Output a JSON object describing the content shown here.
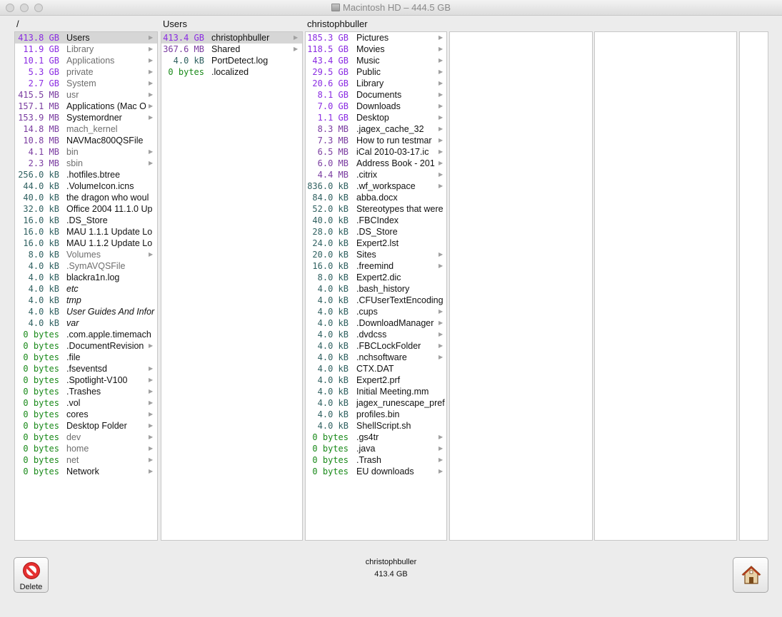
{
  "window": {
    "title": "Macintosh HD – 444.5 GB"
  },
  "columns": [
    {
      "header": "/",
      "rows": [
        {
          "size": "413.8 GB",
          "unit": "gb",
          "name": "Users",
          "arrow": true,
          "selected": true
        },
        {
          "size": "11.9 GB",
          "unit": "gb",
          "name": "Library",
          "arrow": true,
          "gray": true
        },
        {
          "size": "10.1 GB",
          "unit": "gb",
          "name": "Applications",
          "arrow": true,
          "gray": true
        },
        {
          "size": "5.3 GB",
          "unit": "gb",
          "name": "private",
          "arrow": true,
          "gray": true
        },
        {
          "size": "2.7 GB",
          "unit": "gb",
          "name": "System",
          "arrow": true,
          "gray": true
        },
        {
          "size": "415.5 MB",
          "unit": "mb",
          "name": "usr",
          "arrow": true,
          "gray": true
        },
        {
          "size": "157.1 MB",
          "unit": "mb",
          "name": "Applications (Mac O",
          "arrow": true
        },
        {
          "size": "153.9 MB",
          "unit": "mb",
          "name": "Systemordner",
          "arrow": true
        },
        {
          "size": "14.8 MB",
          "unit": "mb",
          "name": "mach_kernel",
          "gray": true
        },
        {
          "size": "10.8 MB",
          "unit": "mb",
          "name": "NAVMac800QSFile"
        },
        {
          "size": "4.1 MB",
          "unit": "mb",
          "name": "bin",
          "arrow": true,
          "gray": true
        },
        {
          "size": "2.3 MB",
          "unit": "mb",
          "name": "sbin",
          "arrow": true,
          "gray": true
        },
        {
          "size": "256.0 kB",
          "unit": "kb",
          "name": ".hotfiles.btree"
        },
        {
          "size": "44.0 kB",
          "unit": "kb",
          "name": ".VolumeIcon.icns"
        },
        {
          "size": "40.0 kB",
          "unit": "kb",
          "name": "the dragon who woul"
        },
        {
          "size": "32.0 kB",
          "unit": "kb",
          "name": "Office 2004 11.1.0 Up"
        },
        {
          "size": "16.0 kB",
          "unit": "kb",
          "name": ".DS_Store"
        },
        {
          "size": "16.0 kB",
          "unit": "kb",
          "name": "MAU 1.1.1 Update Lo"
        },
        {
          "size": "16.0 kB",
          "unit": "kb",
          "name": "MAU 1.1.2 Update Lo"
        },
        {
          "size": "8.0 kB",
          "unit": "kb",
          "name": "Volumes",
          "arrow": true,
          "gray": true
        },
        {
          "size": "4.0 kB",
          "unit": "kb",
          "name": ".SymAVQSFile",
          "gray": true
        },
        {
          "size": "4.0 kB",
          "unit": "kb",
          "name": "blackra1n.log"
        },
        {
          "size": "4.0 kB",
          "unit": "kb",
          "name": "etc",
          "italic": true
        },
        {
          "size": "4.0 kB",
          "unit": "kb",
          "name": "tmp",
          "italic": true
        },
        {
          "size": "4.0 kB",
          "unit": "kb",
          "name": "User Guides And Infor",
          "italic": true
        },
        {
          "size": "4.0 kB",
          "unit": "kb",
          "name": "var",
          "italic": true
        },
        {
          "size": "0 bytes",
          "unit": "bytes",
          "name": ".com.apple.timemach"
        },
        {
          "size": "0 bytes",
          "unit": "bytes",
          "name": ".DocumentRevision",
          "arrow": true
        },
        {
          "size": "0 bytes",
          "unit": "bytes",
          "name": ".file"
        },
        {
          "size": "0 bytes",
          "unit": "bytes",
          "name": ".fseventsd",
          "arrow": true
        },
        {
          "size": "0 bytes",
          "unit": "bytes",
          "name": ".Spotlight-V100",
          "arrow": true
        },
        {
          "size": "0 bytes",
          "unit": "bytes",
          "name": ".Trashes",
          "arrow": true
        },
        {
          "size": "0 bytes",
          "unit": "bytes",
          "name": ".vol",
          "arrow": true
        },
        {
          "size": "0 bytes",
          "unit": "bytes",
          "name": "cores",
          "arrow": true
        },
        {
          "size": "0 bytes",
          "unit": "bytes",
          "name": "Desktop Folder",
          "arrow": true
        },
        {
          "size": "0 bytes",
          "unit": "bytes",
          "name": "dev",
          "arrow": true,
          "gray": true
        },
        {
          "size": "0 bytes",
          "unit": "bytes",
          "name": "home",
          "arrow": true,
          "gray": true
        },
        {
          "size": "0 bytes",
          "unit": "bytes",
          "name": "net",
          "arrow": true,
          "gray": true
        },
        {
          "size": "0 bytes",
          "unit": "bytes",
          "name": "Network",
          "arrow": true
        }
      ]
    },
    {
      "header": "Users",
      "rows": [
        {
          "size": "413.4 GB",
          "unit": "gb",
          "name": "christophbuller",
          "arrow": true,
          "selected": true
        },
        {
          "size": "367.6 MB",
          "unit": "mb",
          "name": "Shared",
          "arrow": true
        },
        {
          "size": "4.0 kB",
          "unit": "kb",
          "name": "PortDetect.log"
        },
        {
          "size": "0 bytes",
          "unit": "bytes",
          "name": ".localized"
        }
      ]
    },
    {
      "header": "christophbuller",
      "rows": [
        {
          "size": "185.3 GB",
          "unit": "gb",
          "name": "Pictures",
          "arrow": true
        },
        {
          "size": "118.5 GB",
          "unit": "gb",
          "name": "Movies",
          "arrow": true
        },
        {
          "size": "43.4 GB",
          "unit": "gb",
          "name": "Music",
          "arrow": true
        },
        {
          "size": "29.5 GB",
          "unit": "gb",
          "name": "Public",
          "arrow": true
        },
        {
          "size": "20.6 GB",
          "unit": "gb",
          "name": "Library",
          "arrow": true
        },
        {
          "size": "8.1 GB",
          "unit": "gb",
          "name": "Documents",
          "arrow": true
        },
        {
          "size": "7.0 GB",
          "unit": "gb",
          "name": "Downloads",
          "arrow": true
        },
        {
          "size": "1.1 GB",
          "unit": "gb",
          "name": "Desktop",
          "arrow": true
        },
        {
          "size": "8.3 MB",
          "unit": "mb",
          "name": ".jagex_cache_32",
          "arrow": true
        },
        {
          "size": "7.3 MB",
          "unit": "mb",
          "name": "How to run testmar",
          "arrow": true
        },
        {
          "size": "6.5 MB",
          "unit": "mb",
          "name": "iCal 2010-03-17.ic",
          "arrow": true
        },
        {
          "size": "6.0 MB",
          "unit": "mb",
          "name": "Address Book - 201",
          "arrow": true
        },
        {
          "size": "4.4 MB",
          "unit": "mb",
          "name": ".citrix",
          "arrow": true
        },
        {
          "size": "836.0 kB",
          "unit": "kb",
          "name": ".wf_workspace",
          "arrow": true
        },
        {
          "size": "84.0 kB",
          "unit": "kb",
          "name": "abba.docx"
        },
        {
          "size": "52.0 kB",
          "unit": "kb",
          "name": "Stereotypes that were"
        },
        {
          "size": "40.0 kB",
          "unit": "kb",
          "name": ".FBCIndex"
        },
        {
          "size": "28.0 kB",
          "unit": "kb",
          "name": ".DS_Store"
        },
        {
          "size": "24.0 kB",
          "unit": "kb",
          "name": "Expert2.lst"
        },
        {
          "size": "20.0 kB",
          "unit": "kb",
          "name": "Sites",
          "arrow": true
        },
        {
          "size": "16.0 kB",
          "unit": "kb",
          "name": ".freemind",
          "arrow": true
        },
        {
          "size": "8.0 kB",
          "unit": "kb",
          "name": "Expert2.dic"
        },
        {
          "size": "4.0 kB",
          "unit": "kb",
          "name": ".bash_history"
        },
        {
          "size": "4.0 kB",
          "unit": "kb",
          "name": ".CFUserTextEncoding"
        },
        {
          "size": "4.0 kB",
          "unit": "kb",
          "name": ".cups",
          "arrow": true
        },
        {
          "size": "4.0 kB",
          "unit": "kb",
          "name": ".DownloadManager",
          "arrow": true
        },
        {
          "size": "4.0 kB",
          "unit": "kb",
          "name": ".dvdcss",
          "arrow": true
        },
        {
          "size": "4.0 kB",
          "unit": "kb",
          "name": ".FBCLockFolder",
          "arrow": true
        },
        {
          "size": "4.0 kB",
          "unit": "kb",
          "name": ".nchsoftware",
          "arrow": true
        },
        {
          "size": "4.0 kB",
          "unit": "kb",
          "name": "CTX.DAT"
        },
        {
          "size": "4.0 kB",
          "unit": "kb",
          "name": "Expert2.prf"
        },
        {
          "size": "4.0 kB",
          "unit": "kb",
          "name": "Initial Meeting.mm"
        },
        {
          "size": "4.0 kB",
          "unit": "kb",
          "name": "jagex_runescape_pref"
        },
        {
          "size": "4.0 kB",
          "unit": "kb",
          "name": "profiles.bin"
        },
        {
          "size": "4.0 kB",
          "unit": "kb",
          "name": "ShellScript.sh"
        },
        {
          "size": "0 bytes",
          "unit": "bytes",
          "name": ".gs4tr",
          "arrow": true
        },
        {
          "size": "0 bytes",
          "unit": "bytes",
          "name": ".java",
          "arrow": true
        },
        {
          "size": "0 bytes",
          "unit": "bytes",
          "name": ".Trash",
          "arrow": true
        },
        {
          "size": "0 bytes",
          "unit": "bytes",
          "name": "EU downloads",
          "arrow": true
        }
      ]
    },
    {
      "header": "",
      "rows": []
    },
    {
      "header": "",
      "rows": []
    },
    {
      "header": "",
      "rows": []
    }
  ],
  "status": {
    "name": "christophbuller",
    "size": "413.4 GB"
  },
  "buttons": {
    "delete_label": "Delete",
    "delete_icon": "no-entry-icon",
    "home_icon": "home-icon"
  },
  "colors": {
    "gb": "#8a2be2",
    "mb": "#7a3ca0",
    "kb": "#2f6060",
    "bytes": "#1a8a1a"
  }
}
